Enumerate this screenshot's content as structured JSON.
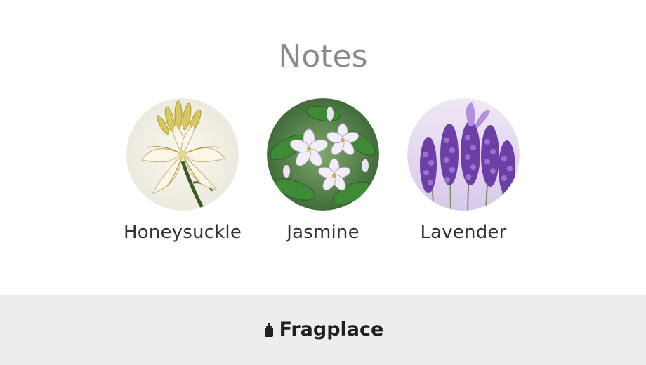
{
  "page": {
    "title": "Notes"
  },
  "notes": [
    {
      "label": "Honeysuckle",
      "icon": "honeysuckle-flower-image",
      "color": "#f3ecd0"
    },
    {
      "label": "Jasmine",
      "icon": "jasmine-flower-image",
      "color": "#3f7a3b"
    },
    {
      "label": "Lavender",
      "icon": "lavender-flower-image",
      "color": "#7a4fb0"
    }
  ],
  "footer": {
    "brand": "Fragplace",
    "icon": "perfume-bottle-icon",
    "background": "#ededed"
  }
}
